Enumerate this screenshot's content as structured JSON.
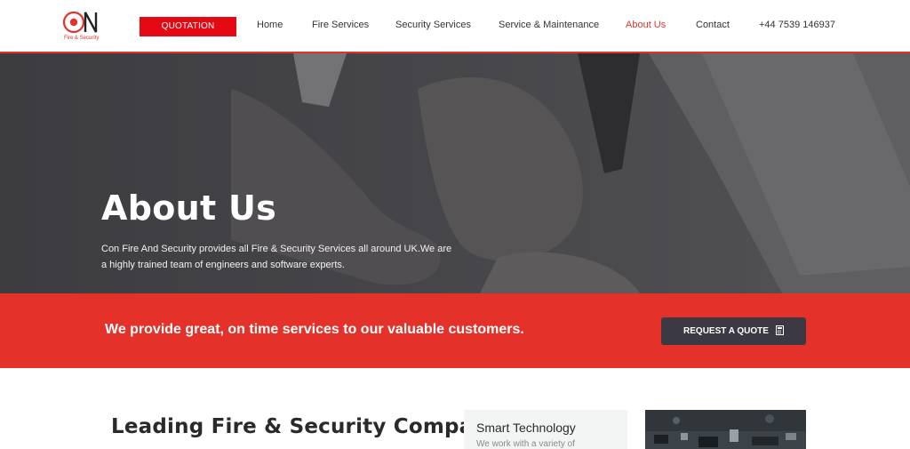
{
  "header": {
    "logo": {
      "wordmark": "CON",
      "subtitle": "Fire & Security"
    },
    "quotation_button": "QUOTATION",
    "nav": [
      {
        "label": "Home",
        "active": false
      },
      {
        "label": "Fire Services",
        "active": false
      },
      {
        "label": "Security Services",
        "active": false
      },
      {
        "label": "Service & Maintenance",
        "active": false
      },
      {
        "label": "About Us",
        "active": true
      },
      {
        "label": "Contact",
        "active": false
      },
      {
        "label": "+44 7539 146937",
        "active": false
      }
    ]
  },
  "hero": {
    "title": "About Us",
    "text": "Con Fire And Security provides all Fire & Security Services all around UK.We are a highly trained team of engineers and software experts."
  },
  "cta": {
    "text": "We provide great, on time services to our valuable customers.",
    "button": "REQUEST A QUOTE",
    "button_icon": "calculator-icon"
  },
  "section": {
    "title": "Leading Fire & Security Company",
    "card": {
      "title": "Smart Technology",
      "text": "We work with a variety of"
    }
  },
  "colors": {
    "brand_red": "#e4322b",
    "dark_button": "#3b3944"
  }
}
